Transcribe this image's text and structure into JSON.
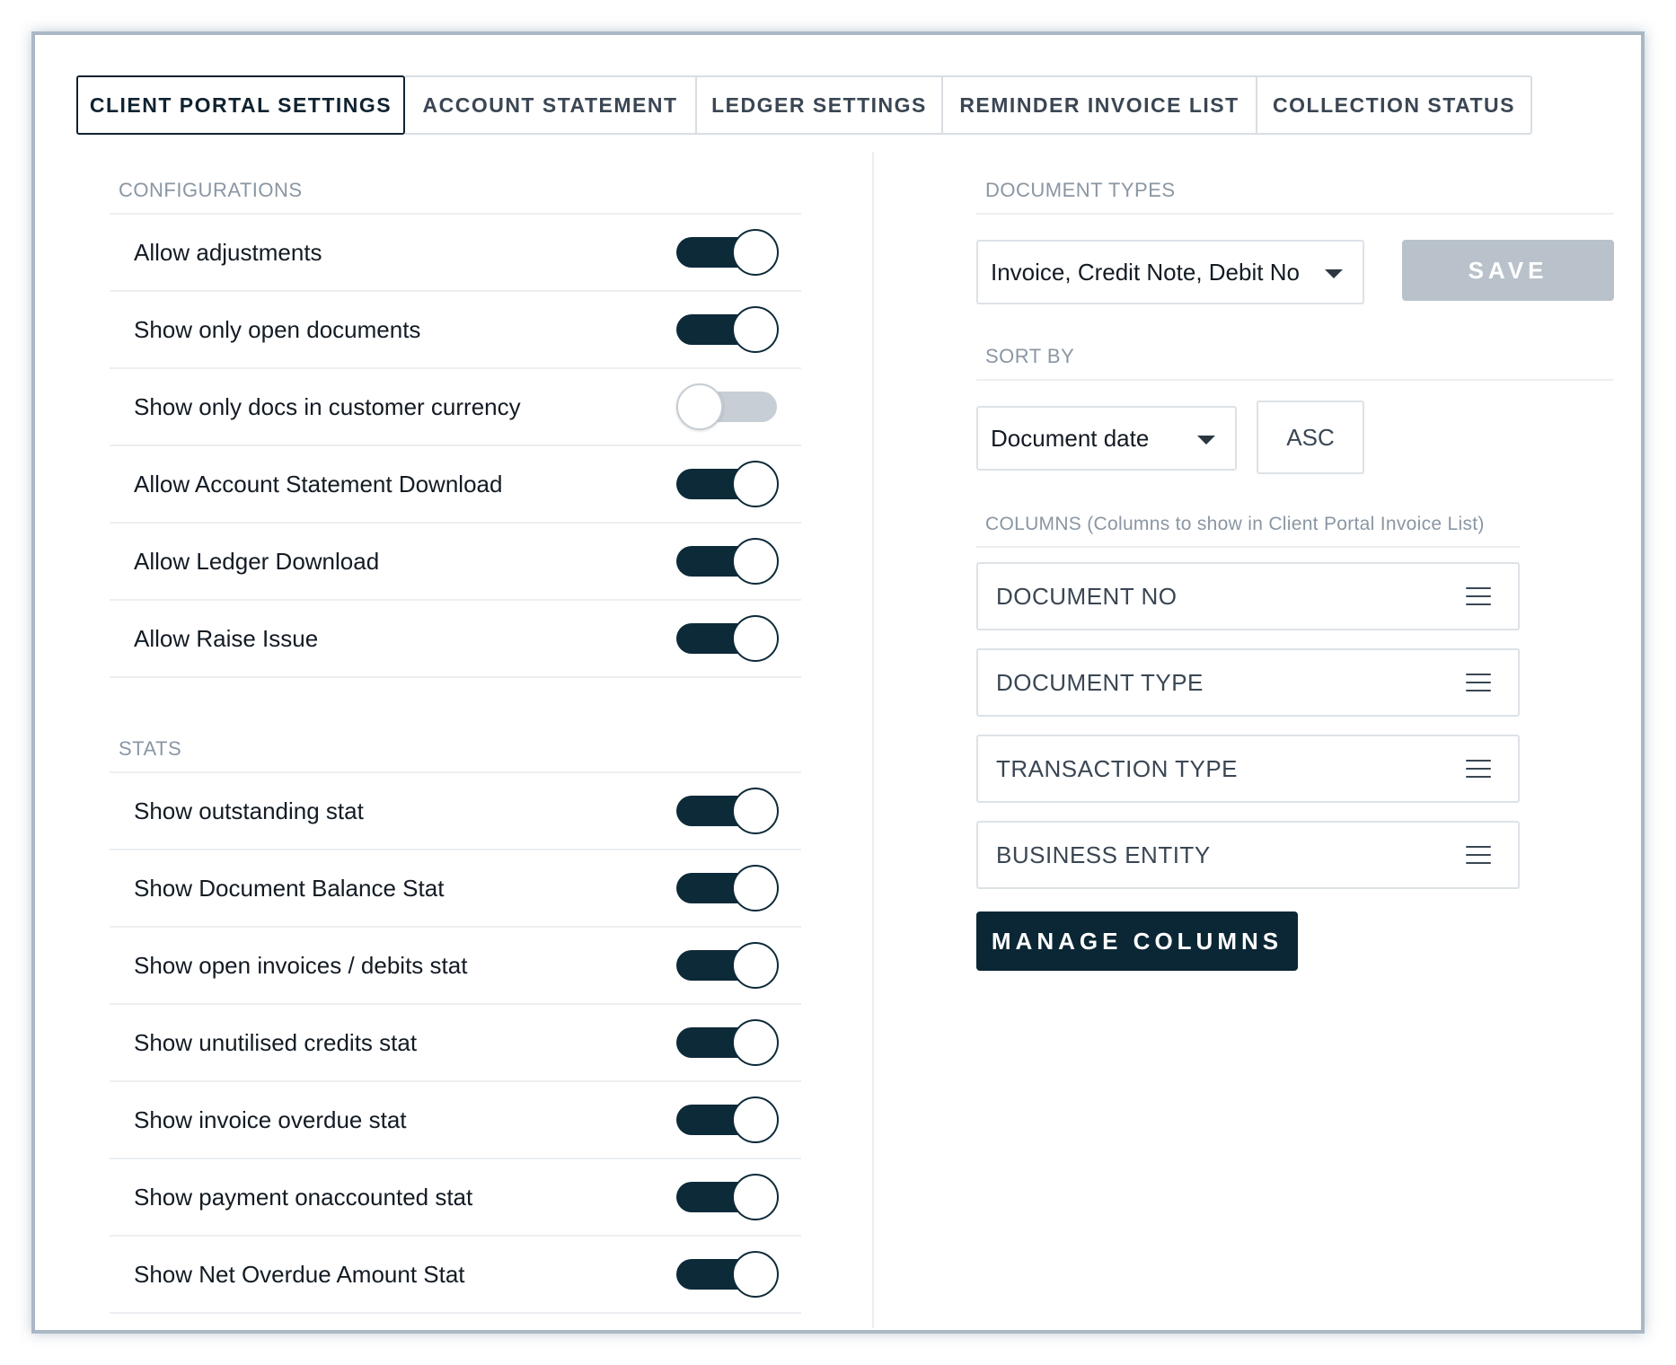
{
  "tabs": [
    {
      "label": "CLIENT PORTAL SETTINGS",
      "active": true
    },
    {
      "label": "ACCOUNT STATEMENT",
      "active": false
    },
    {
      "label": "LEDGER SETTINGS",
      "active": false
    },
    {
      "label": "REMINDER INVOICE LIST",
      "active": false
    },
    {
      "label": "COLLECTION STATUS",
      "active": false
    }
  ],
  "configurations": {
    "title": "CONFIGURATIONS",
    "items": [
      {
        "label": "Allow adjustments",
        "enabled": true
      },
      {
        "label": "Show only open documents",
        "enabled": true
      },
      {
        "label": "Show only docs in customer currency",
        "enabled": false
      },
      {
        "label": "Allow Account Statement Download",
        "enabled": true
      },
      {
        "label": "Allow Ledger Download",
        "enabled": true
      },
      {
        "label": "Allow Raise Issue",
        "enabled": true
      }
    ]
  },
  "stats": {
    "title": "STATS",
    "items": [
      {
        "label": "Show outstanding stat",
        "enabled": true
      },
      {
        "label": "Show Document Balance Stat",
        "enabled": true
      },
      {
        "label": "Show open invoices / debits stat",
        "enabled": true
      },
      {
        "label": "Show unutilised credits stat",
        "enabled": true
      },
      {
        "label": "Show invoice overdue stat",
        "enabled": true
      },
      {
        "label": "Show payment onaccounted stat",
        "enabled": true
      },
      {
        "label": "Show Net Overdue Amount Stat",
        "enabled": true
      }
    ]
  },
  "document_types": {
    "title": "DOCUMENT TYPES",
    "selected": "Invoice, Credit Note, Debit Note",
    "save_label": "SAVE"
  },
  "sort_by": {
    "title": "SORT BY",
    "selected": "Document date",
    "order": "ASC"
  },
  "columns": {
    "title": "COLUMNS (Columns to show in Client Portal Invoice List)",
    "items": [
      "DOCUMENT NO",
      "DOCUMENT TYPE",
      "TRANSACTION TYPE",
      "BUSINESS ENTITY"
    ],
    "manage_label": "MANAGE COLUMNS"
  },
  "colors": {
    "primary": "#0b2735",
    "toggle_off": "#c8ced5",
    "save_disabled": "#b9c2cb",
    "section_title": "#8a96a3"
  }
}
